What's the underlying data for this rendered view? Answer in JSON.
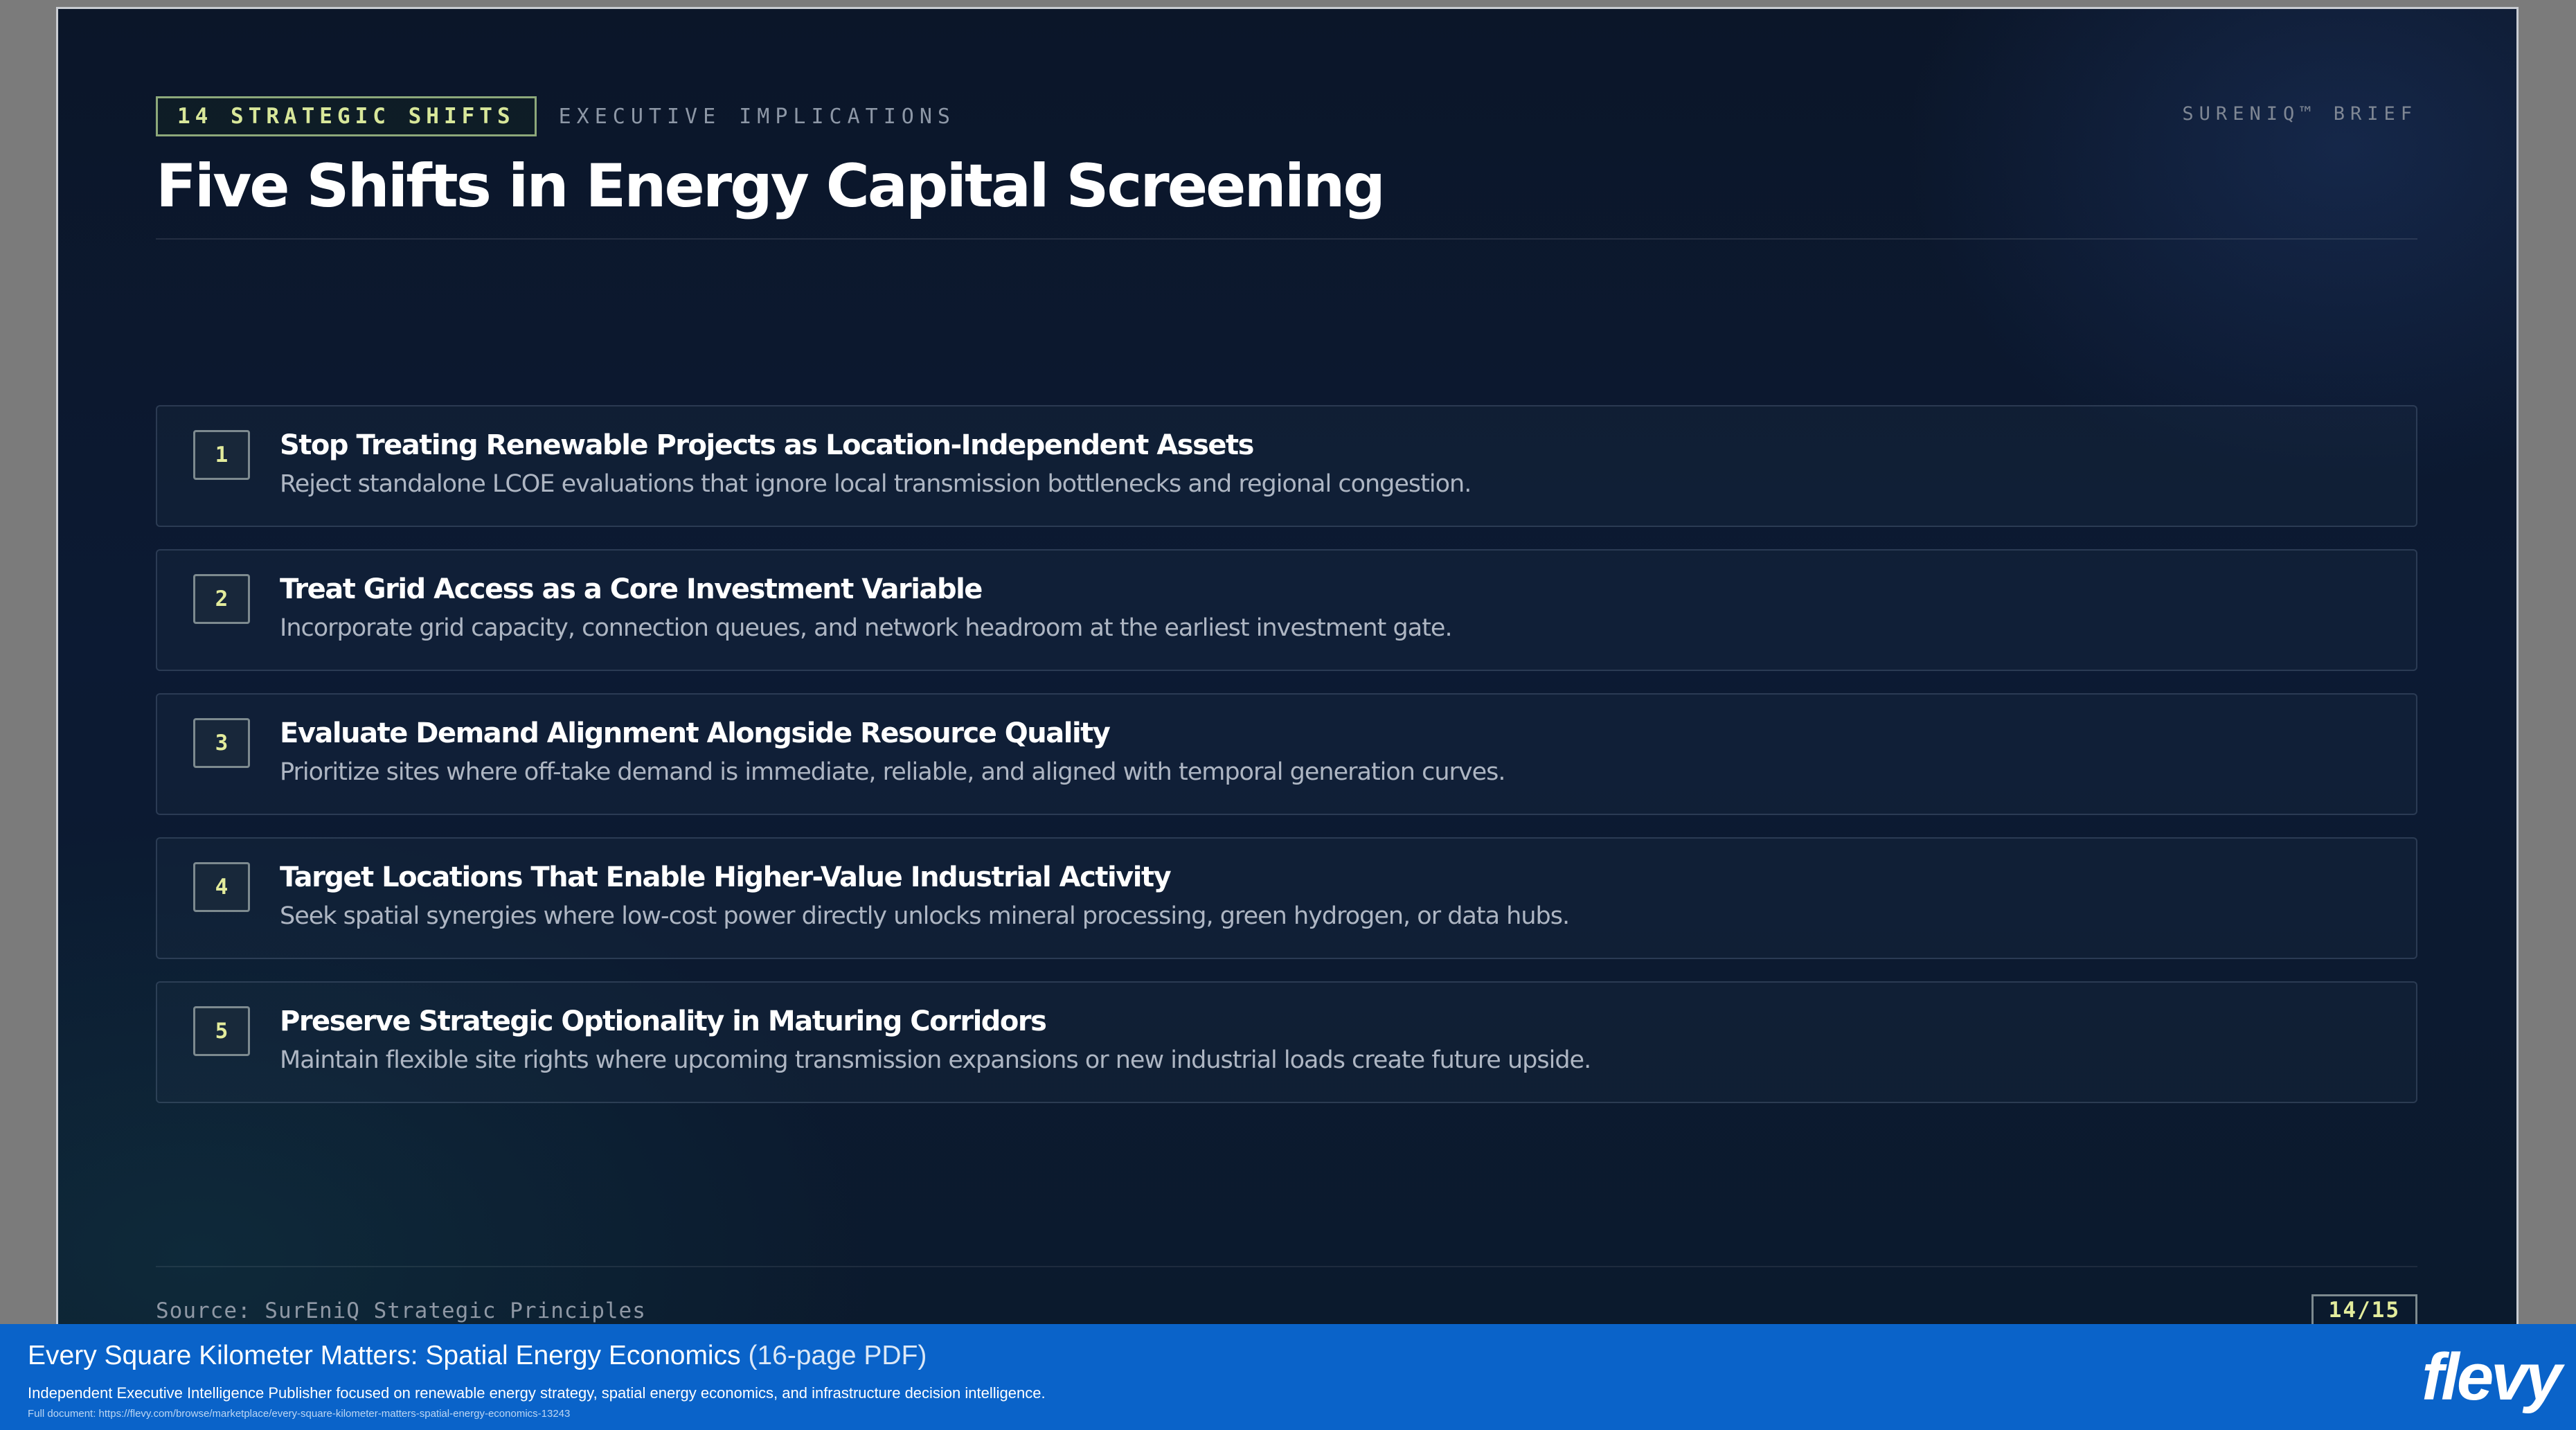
{
  "slide": {
    "section_tag": "14 STRATEGIC SHIFTS",
    "section_subtitle": "EXECUTIVE IMPLICATIONS",
    "brand": "SURENIQ™ BRIEF",
    "title": "Five Shifts in Energy Capital Screening",
    "items": [
      {
        "number": "1",
        "title": "Stop Treating Renewable Projects as Location-Independent Assets",
        "description": "Reject standalone LCOE evaluations that ignore local transmission bottlenecks and regional congestion."
      },
      {
        "number": "2",
        "title": "Treat Grid Access as a Core Investment Variable",
        "description": "Incorporate grid capacity, connection queues, and network headroom at the earliest investment gate."
      },
      {
        "number": "3",
        "title": "Evaluate Demand Alignment Alongside Resource Quality",
        "description": "Prioritize sites where off-take demand is immediate, reliable, and aligned with temporal generation curves."
      },
      {
        "number": "4",
        "title": "Target Locations That Enable Higher-Value Industrial Activity",
        "description": "Seek spatial synergies where low-cost power directly unlocks mineral processing, green hydrogen, or data hubs."
      },
      {
        "number": "5",
        "title": "Preserve Strategic Optionality in Maturing Corridors",
        "description": "Maintain flexible site rights where upcoming transmission expansions or new industrial loads create future upside."
      }
    ],
    "source": "Source: SurEniQ Strategic Principles",
    "page_indicator": "14/15"
  },
  "banner": {
    "title": "Every Square Kilometer Matters: Spatial Energy Economics",
    "pages": "(16-page PDF)",
    "description": "Independent Executive Intelligence Publisher focused on renewable energy strategy, spatial energy economics, and infrastructure decision intelligence.",
    "link": "Full document: https://flevy.com/browse/marketplace/every-square-kilometer-matters-spatial-energy-economics-13243",
    "logo": "flevy"
  },
  "colors": {
    "background": "#0b1629",
    "accent": "#d8e79a",
    "banner": "#0a63c9"
  }
}
